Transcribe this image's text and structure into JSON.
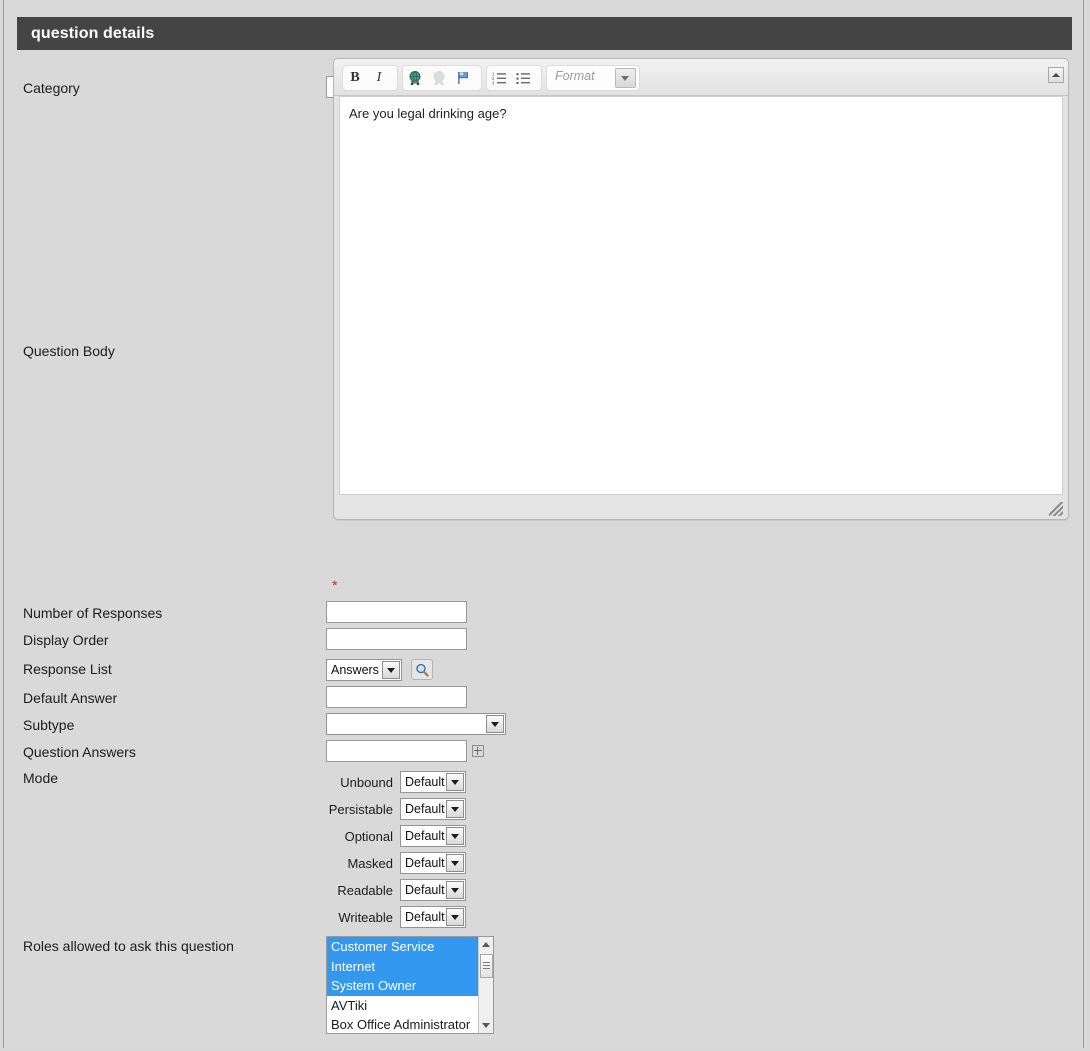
{
  "panel": {
    "title": "question details"
  },
  "fields": {
    "category": {
      "label": "Category",
      "value": "",
      "placeholder": ""
    },
    "question_body": {
      "label": "Question Body",
      "content": "Are you legal drinking age?",
      "required_marker": "*",
      "toolbar": {
        "bold": "B",
        "italic": "I",
        "format_placeholder": "Format"
      }
    },
    "number_of_responses": {
      "label": "Number of Responses",
      "value": ""
    },
    "display_order": {
      "label": "Display Order",
      "value": ""
    },
    "response_list": {
      "label": "Response List",
      "value": "Answers"
    },
    "default_answer": {
      "label": "Default Answer",
      "value": ""
    },
    "subtype": {
      "label": "Subtype",
      "value": ""
    },
    "question_answers": {
      "label": "Question Answers",
      "value": ""
    },
    "mode": {
      "label": "Mode",
      "rows": [
        {
          "name": "Unbound",
          "value": "Default"
        },
        {
          "name": "Persistable",
          "value": "Default"
        },
        {
          "name": "Optional",
          "value": "Default"
        },
        {
          "name": "Masked",
          "value": "Default"
        },
        {
          "name": "Readable",
          "value": "Default"
        },
        {
          "name": "Writeable",
          "value": "Default"
        }
      ]
    },
    "roles": {
      "label": "Roles allowed to ask this question",
      "options": [
        {
          "text": "Customer Service",
          "selected": true
        },
        {
          "text": "Internet",
          "selected": true
        },
        {
          "text": "System Owner",
          "selected": true
        },
        {
          "text": "AVTiki",
          "selected": false
        },
        {
          "text": "Box Office Administrator",
          "selected": false
        }
      ]
    }
  },
  "colors": {
    "header_bg": "#444444",
    "page_bg": "#d9d9d9",
    "selection_blue": "#3399f0",
    "required_red": "#e02020"
  }
}
